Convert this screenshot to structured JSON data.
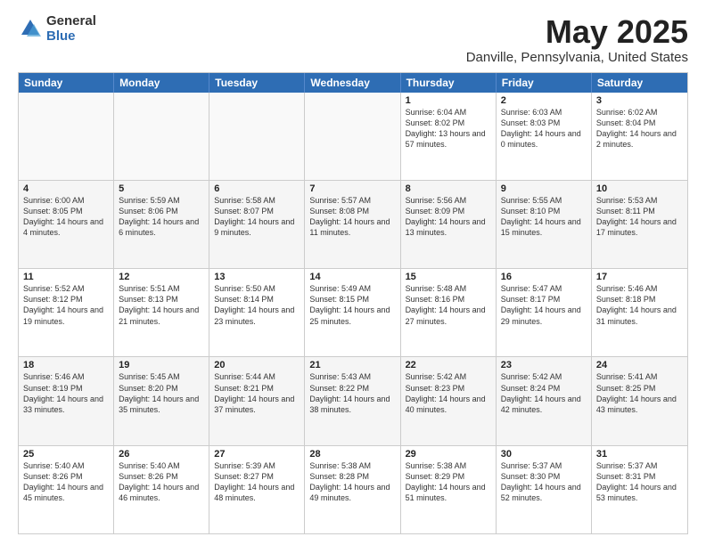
{
  "logo": {
    "general": "General",
    "blue": "Blue"
  },
  "title": "May 2025",
  "subtitle": "Danville, Pennsylvania, United States",
  "weekdays": [
    "Sunday",
    "Monday",
    "Tuesday",
    "Wednesday",
    "Thursday",
    "Friday",
    "Saturday"
  ],
  "weeks": [
    [
      {
        "num": "",
        "text": ""
      },
      {
        "num": "",
        "text": ""
      },
      {
        "num": "",
        "text": ""
      },
      {
        "num": "",
        "text": ""
      },
      {
        "num": "1",
        "text": "Sunrise: 6:04 AM\nSunset: 8:02 PM\nDaylight: 13 hours\nand 57 minutes."
      },
      {
        "num": "2",
        "text": "Sunrise: 6:03 AM\nSunset: 8:03 PM\nDaylight: 14 hours\nand 0 minutes."
      },
      {
        "num": "3",
        "text": "Sunrise: 6:02 AM\nSunset: 8:04 PM\nDaylight: 14 hours\nand 2 minutes."
      }
    ],
    [
      {
        "num": "4",
        "text": "Sunrise: 6:00 AM\nSunset: 8:05 PM\nDaylight: 14 hours\nand 4 minutes."
      },
      {
        "num": "5",
        "text": "Sunrise: 5:59 AM\nSunset: 8:06 PM\nDaylight: 14 hours\nand 6 minutes."
      },
      {
        "num": "6",
        "text": "Sunrise: 5:58 AM\nSunset: 8:07 PM\nDaylight: 14 hours\nand 9 minutes."
      },
      {
        "num": "7",
        "text": "Sunrise: 5:57 AM\nSunset: 8:08 PM\nDaylight: 14 hours\nand 11 minutes."
      },
      {
        "num": "8",
        "text": "Sunrise: 5:56 AM\nSunset: 8:09 PM\nDaylight: 14 hours\nand 13 minutes."
      },
      {
        "num": "9",
        "text": "Sunrise: 5:55 AM\nSunset: 8:10 PM\nDaylight: 14 hours\nand 15 minutes."
      },
      {
        "num": "10",
        "text": "Sunrise: 5:53 AM\nSunset: 8:11 PM\nDaylight: 14 hours\nand 17 minutes."
      }
    ],
    [
      {
        "num": "11",
        "text": "Sunrise: 5:52 AM\nSunset: 8:12 PM\nDaylight: 14 hours\nand 19 minutes."
      },
      {
        "num": "12",
        "text": "Sunrise: 5:51 AM\nSunset: 8:13 PM\nDaylight: 14 hours\nand 21 minutes."
      },
      {
        "num": "13",
        "text": "Sunrise: 5:50 AM\nSunset: 8:14 PM\nDaylight: 14 hours\nand 23 minutes."
      },
      {
        "num": "14",
        "text": "Sunrise: 5:49 AM\nSunset: 8:15 PM\nDaylight: 14 hours\nand 25 minutes."
      },
      {
        "num": "15",
        "text": "Sunrise: 5:48 AM\nSunset: 8:16 PM\nDaylight: 14 hours\nand 27 minutes."
      },
      {
        "num": "16",
        "text": "Sunrise: 5:47 AM\nSunset: 8:17 PM\nDaylight: 14 hours\nand 29 minutes."
      },
      {
        "num": "17",
        "text": "Sunrise: 5:46 AM\nSunset: 8:18 PM\nDaylight: 14 hours\nand 31 minutes."
      }
    ],
    [
      {
        "num": "18",
        "text": "Sunrise: 5:46 AM\nSunset: 8:19 PM\nDaylight: 14 hours\nand 33 minutes."
      },
      {
        "num": "19",
        "text": "Sunrise: 5:45 AM\nSunset: 8:20 PM\nDaylight: 14 hours\nand 35 minutes."
      },
      {
        "num": "20",
        "text": "Sunrise: 5:44 AM\nSunset: 8:21 PM\nDaylight: 14 hours\nand 37 minutes."
      },
      {
        "num": "21",
        "text": "Sunrise: 5:43 AM\nSunset: 8:22 PM\nDaylight: 14 hours\nand 38 minutes."
      },
      {
        "num": "22",
        "text": "Sunrise: 5:42 AM\nSunset: 8:23 PM\nDaylight: 14 hours\nand 40 minutes."
      },
      {
        "num": "23",
        "text": "Sunrise: 5:42 AM\nSunset: 8:24 PM\nDaylight: 14 hours\nand 42 minutes."
      },
      {
        "num": "24",
        "text": "Sunrise: 5:41 AM\nSunset: 8:25 PM\nDaylight: 14 hours\nand 43 minutes."
      }
    ],
    [
      {
        "num": "25",
        "text": "Sunrise: 5:40 AM\nSunset: 8:26 PM\nDaylight: 14 hours\nand 45 minutes."
      },
      {
        "num": "26",
        "text": "Sunrise: 5:40 AM\nSunset: 8:26 PM\nDaylight: 14 hours\nand 46 minutes."
      },
      {
        "num": "27",
        "text": "Sunrise: 5:39 AM\nSunset: 8:27 PM\nDaylight: 14 hours\nand 48 minutes."
      },
      {
        "num": "28",
        "text": "Sunrise: 5:38 AM\nSunset: 8:28 PM\nDaylight: 14 hours\nand 49 minutes."
      },
      {
        "num": "29",
        "text": "Sunrise: 5:38 AM\nSunset: 8:29 PM\nDaylight: 14 hours\nand 51 minutes."
      },
      {
        "num": "30",
        "text": "Sunrise: 5:37 AM\nSunset: 8:30 PM\nDaylight: 14 hours\nand 52 minutes."
      },
      {
        "num": "31",
        "text": "Sunrise: 5:37 AM\nSunset: 8:31 PM\nDaylight: 14 hours\nand 53 minutes."
      }
    ]
  ]
}
